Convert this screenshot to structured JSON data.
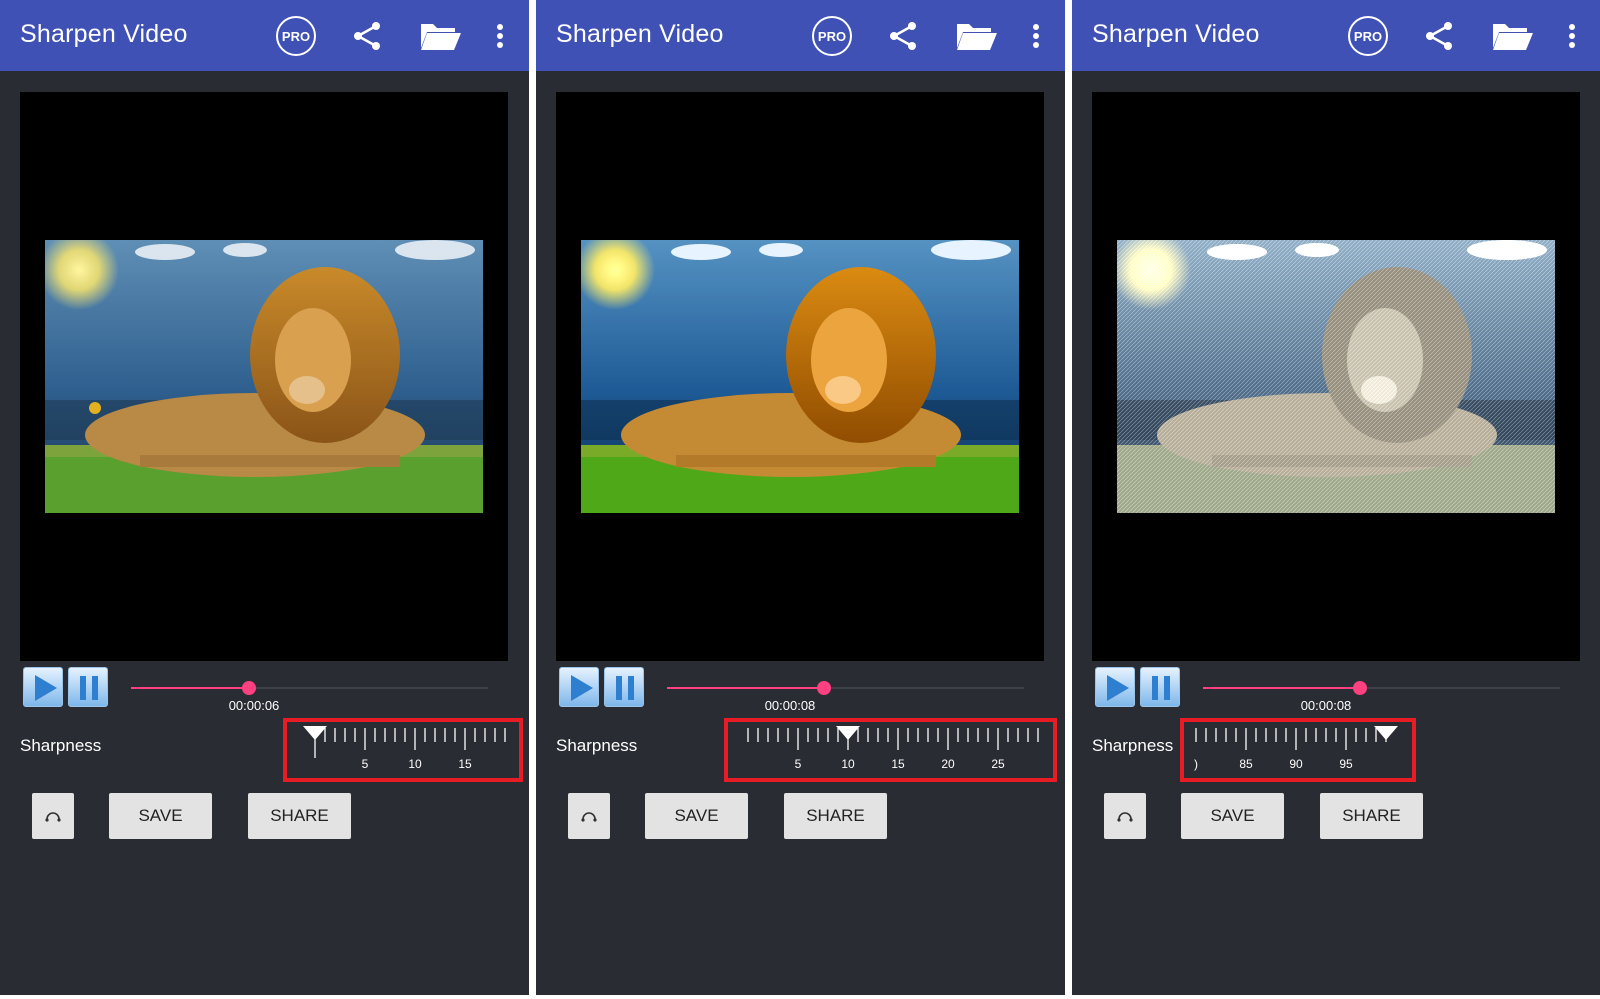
{
  "screens": [
    {
      "title": "Sharpen Video",
      "pro_label": "PRO",
      "time": "00:00:06",
      "seek_progress": 0.33,
      "sharpness_label": "Sharpness",
      "ruler_labels": [
        "5",
        "10",
        "15"
      ],
      "sharpness_value": 0,
      "filter": "none",
      "save_label": "SAVE",
      "share_label": "SHARE"
    },
    {
      "title": "Sharpen Video",
      "pro_label": "PRO",
      "time": "00:00:08",
      "seek_progress": 0.44,
      "sharpness_label": "Sharpness",
      "ruler_labels": [
        "5",
        "10",
        "15",
        "20",
        "25"
      ],
      "sharpness_value": 10,
      "filter": "mid",
      "save_label": "SAVE",
      "share_label": "SHARE"
    },
    {
      "title": "Sharpen Video",
      "pro_label": "PRO",
      "time": "00:00:08",
      "seek_progress": 0.44,
      "sharpness_label": "Sharpness",
      "ruler_labels": [
        ")",
        "85",
        "90",
        "95"
      ],
      "sharpness_value": 100,
      "filter": "max",
      "save_label": "SAVE",
      "share_label": "SHARE"
    }
  ],
  "icons": {
    "share": "share-icon",
    "folder": "folder-open-icon",
    "more": "more-vertical-icon",
    "play": "play-icon",
    "pause": "pause-icon",
    "reset": "reset-icon"
  },
  "colors": {
    "appbar": "#3f51b5",
    "background": "#2a2c33",
    "accent": "#ff4081",
    "highlight_box": "#e81c24"
  }
}
